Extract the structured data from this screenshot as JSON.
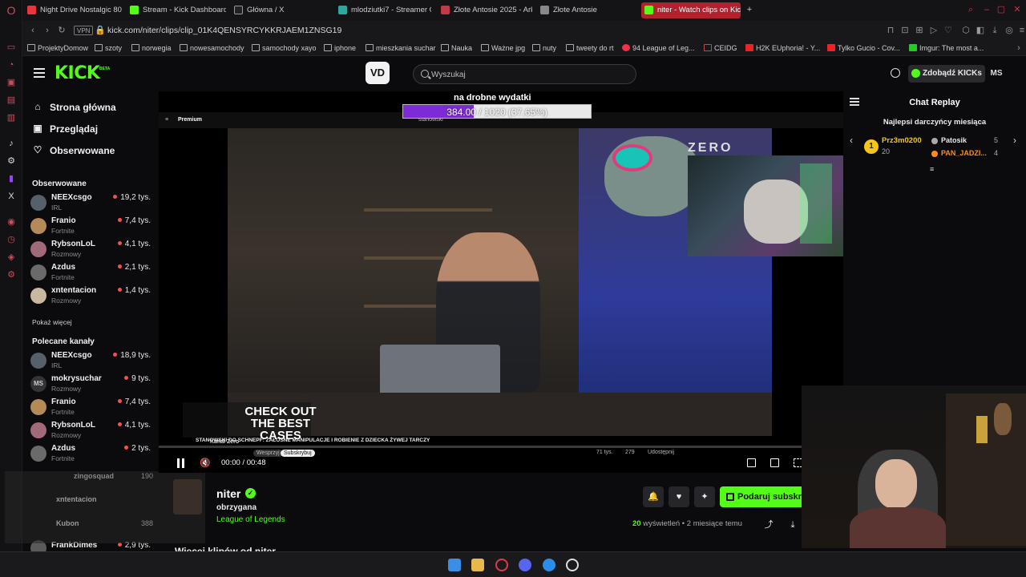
{
  "browser": {
    "tabs": [
      {
        "label": "Night Drive Nostalgic 80s",
        "color": "#e8373c"
      },
      {
        "label": "Stream - Kick Dashboard",
        "color": "#53fc18"
      },
      {
        "label": "Główna / X",
        "color": "#dddddd"
      },
      {
        "label": "mlodziutki7 - Streamer O",
        "color": "#2ea7a0"
      },
      {
        "label": "Złote Antosie 2025 - Arku",
        "color": "#c23a48"
      },
      {
        "label": "Złote Antosie",
        "color": "#888888"
      },
      {
        "label": "niter - Watch clips on Kick",
        "color": "#53fc18"
      }
    ],
    "vpn_label": "VPN",
    "url": "kick.com/niter/clips/clip_01K4QENSYRCYKKRJAEM1ZNSG19",
    "bookmarks": [
      "ProjektyDomow",
      "szoty",
      "norwegia",
      "nowesamochody",
      "samochody xayo",
      "iphone",
      "mieszkania suchar",
      "Nauka",
      "Ważne jpg",
      "nuty",
      "tweety do rt",
      "94 League of Leg...",
      "CEIDG",
      "H2K EUphoria! - Y...",
      "Tylko Gucio - Cov...",
      "Imgur: The most a..."
    ]
  },
  "header": {
    "logo": "KICK",
    "logo_beta": "BETA",
    "ext_icon": "VD",
    "search_placeholder": "Wyszukaj",
    "kicks_button": "Zdobądź KICKs",
    "avatar": "MS"
  },
  "sidebar": {
    "nav": [
      {
        "label": "Strona główna",
        "icon": "home-icon"
      },
      {
        "label": "Przeglądaj",
        "icon": "browse-icon"
      },
      {
        "label": "Obserwowane",
        "icon": "heart-icon"
      }
    ],
    "followed_title": "Obserwowane",
    "followed": [
      {
        "name": "NEEXcsgo",
        "category": "IRL",
        "viewers": "19,2 tys.",
        "color": "#55606a"
      },
      {
        "name": "Franio",
        "category": "Fortnite",
        "viewers": "7,4 tys.",
        "color": "#b48a58"
      },
      {
        "name": "RybsonLoL",
        "category": "Rozmowy",
        "viewers": "4,1 tys.",
        "color": "#a06a7a"
      },
      {
        "name": "Azdus",
        "category": "Fortnite",
        "viewers": "2,1 tys.",
        "color": "#6a6a6a"
      },
      {
        "name": "xntentacion",
        "category": "Rozmowy",
        "viewers": "1,4 tys.",
        "color": "#c9b8a0"
      }
    ],
    "show_more": "Pokaż więcej",
    "recommended_title": "Polecane kanały",
    "recommended": [
      {
        "name": "NEEXcsgo",
        "category": "IRL",
        "viewers": "18,9 tys.",
        "color": "#55606a"
      },
      {
        "name": "mokrysuchar",
        "category": "Rozmowy",
        "viewers": "9 tys.",
        "color": "#333338",
        "initials": "MS"
      },
      {
        "name": "Franio",
        "category": "Fortnite",
        "viewers": "7,4 tys.",
        "color": "#b48a58"
      },
      {
        "name": "RybsonLoL",
        "category": "Rozmowy",
        "viewers": "4,1 tys.",
        "color": "#a06a7a"
      },
      {
        "name": "Azdus",
        "category": "Fortnite",
        "viewers": "2 tys.",
        "color": "#6a6a6a"
      }
    ],
    "ghost_items": [
      {
        "name": "zingosquad",
        "viewers": "190"
      },
      {
        "name": "xntentacion",
        "viewers": ""
      },
      {
        "name": "Kubon",
        "viewers": "388"
      }
    ],
    "last_item": {
      "name": "FrankDimes",
      "viewers": "2,9 tys."
    }
  },
  "video": {
    "goal_text": "na drobne wydatki",
    "goal_label": "384.00 / 1020 (37.65%)",
    "goal_progress": 37.65,
    "yt_premium": "Premium",
    "yt_channel": "stanowski",
    "zero_logo": "ZERO",
    "case_text": "CHECK OUT THE BEST CASES",
    "yt_caption": "STANOWSKI DO SCHNEPF: ŻAŁOSNE MANIPULACJE I ROBIENIE Z DZIECKA ŻYWEJ TARCZY",
    "yt_channel_name": "Kanał Zero",
    "yt_subscribe": "Subskrybuj",
    "yt_join": "Wesprzyj",
    "yt_likes": "71 tys.",
    "yt_comments": "279",
    "yt_share": "Udostępnij",
    "time_current": "00:00",
    "time_total": "00:48"
  },
  "clip": {
    "streamer": "niter",
    "title": "obrzygana",
    "category": "League of Legends",
    "gift_button": "Podaruj subskrypcje",
    "views_count": "20",
    "views_label": "wyświetleń",
    "age": "2 miesiące temu",
    "more_clips": "Więcej klipów od niter"
  },
  "chat": {
    "title": "Chat Replay",
    "gifters_title": "Najlepsi darczyńcy miesiąca",
    "top_gifter": {
      "rank": "1",
      "name": "Prz3m0200",
      "count": "20"
    },
    "other_gifters": [
      {
        "name": "Patosik",
        "count": "5",
        "color": "#e8e8e8"
      },
      {
        "name": "PAN_JADZI...",
        "count": "4",
        "color": "#ff8c1a"
      }
    ]
  },
  "colors": {
    "kick_green": "#53fc18",
    "opera_red": "#c23a48",
    "live_dot": "#ff4d4d",
    "goal_purple": "#7d2bd6"
  }
}
